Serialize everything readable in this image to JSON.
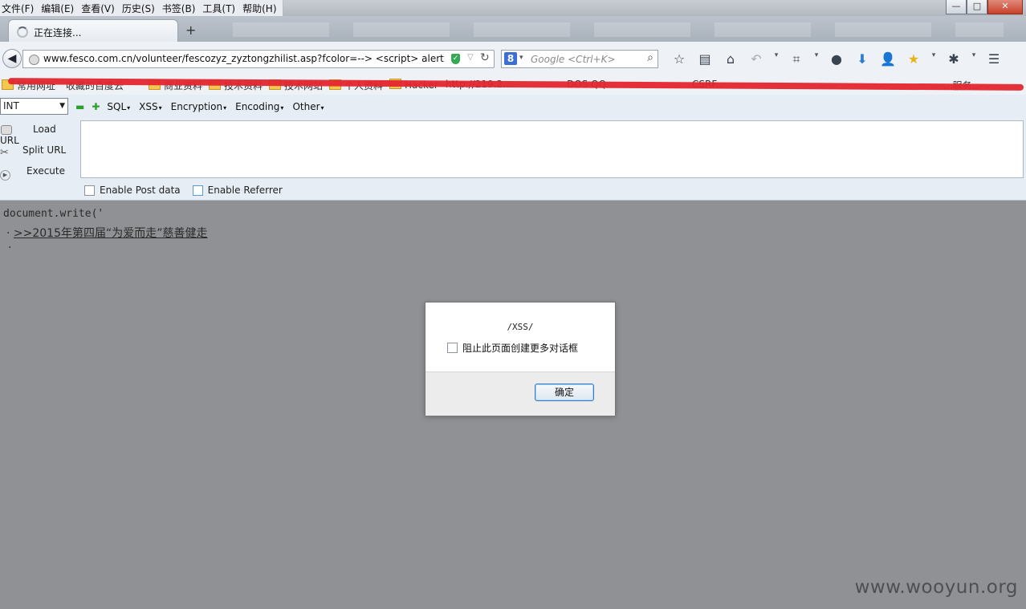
{
  "menu": [
    "文件(F)",
    "编辑(E)",
    "查看(V)",
    "历史(S)",
    "书签(B)",
    "工具(T)",
    "帮助(H)"
  ],
  "window_buttons": {
    "minimize": "—",
    "maximize": "□",
    "close": "✕"
  },
  "tab": {
    "label": "正在连接...",
    "new_tab": "+"
  },
  "urlbar": {
    "url": "www.fesco.com.cn/volunteer/fescozyz_zyztongzhilist.asp?fcolor=--> <script> alert(/XSS/)"
  },
  "search": {
    "placeholder": "Google <Ctrl+K>",
    "engine_letter": "8"
  },
  "bookmarks": [
    "常用网址",
    "收藏的百度云",
    "商业资料",
    "技术资料",
    "技术网站",
    "个人资料",
    "Hacker",
    "http://219.2...",
    "DOS QQ...",
    "CSRF...",
    "...",
    "...服务..."
  ],
  "hackbar": {
    "select_value": "INT",
    "menu": [
      "SQL",
      "XSS",
      "Encryption",
      "Encoding",
      "Other"
    ],
    "load_url": "Load URL",
    "split_url": "Split URL",
    "execute": "Execute",
    "enable_post": "Enable Post data",
    "enable_referrer": "Enable Referrer"
  },
  "content": {
    "doc_write": "document.write('",
    "bullet": "·",
    "news_link": ">>2015年第四届“为爱而走”慈善健走",
    "second_bullet": "·",
    "watermark": "www.wooyun.org"
  },
  "dialog": {
    "message": "/XSS/",
    "checkbox_label": "阻止此页面创建更多对话框",
    "ok_label": "确定"
  }
}
